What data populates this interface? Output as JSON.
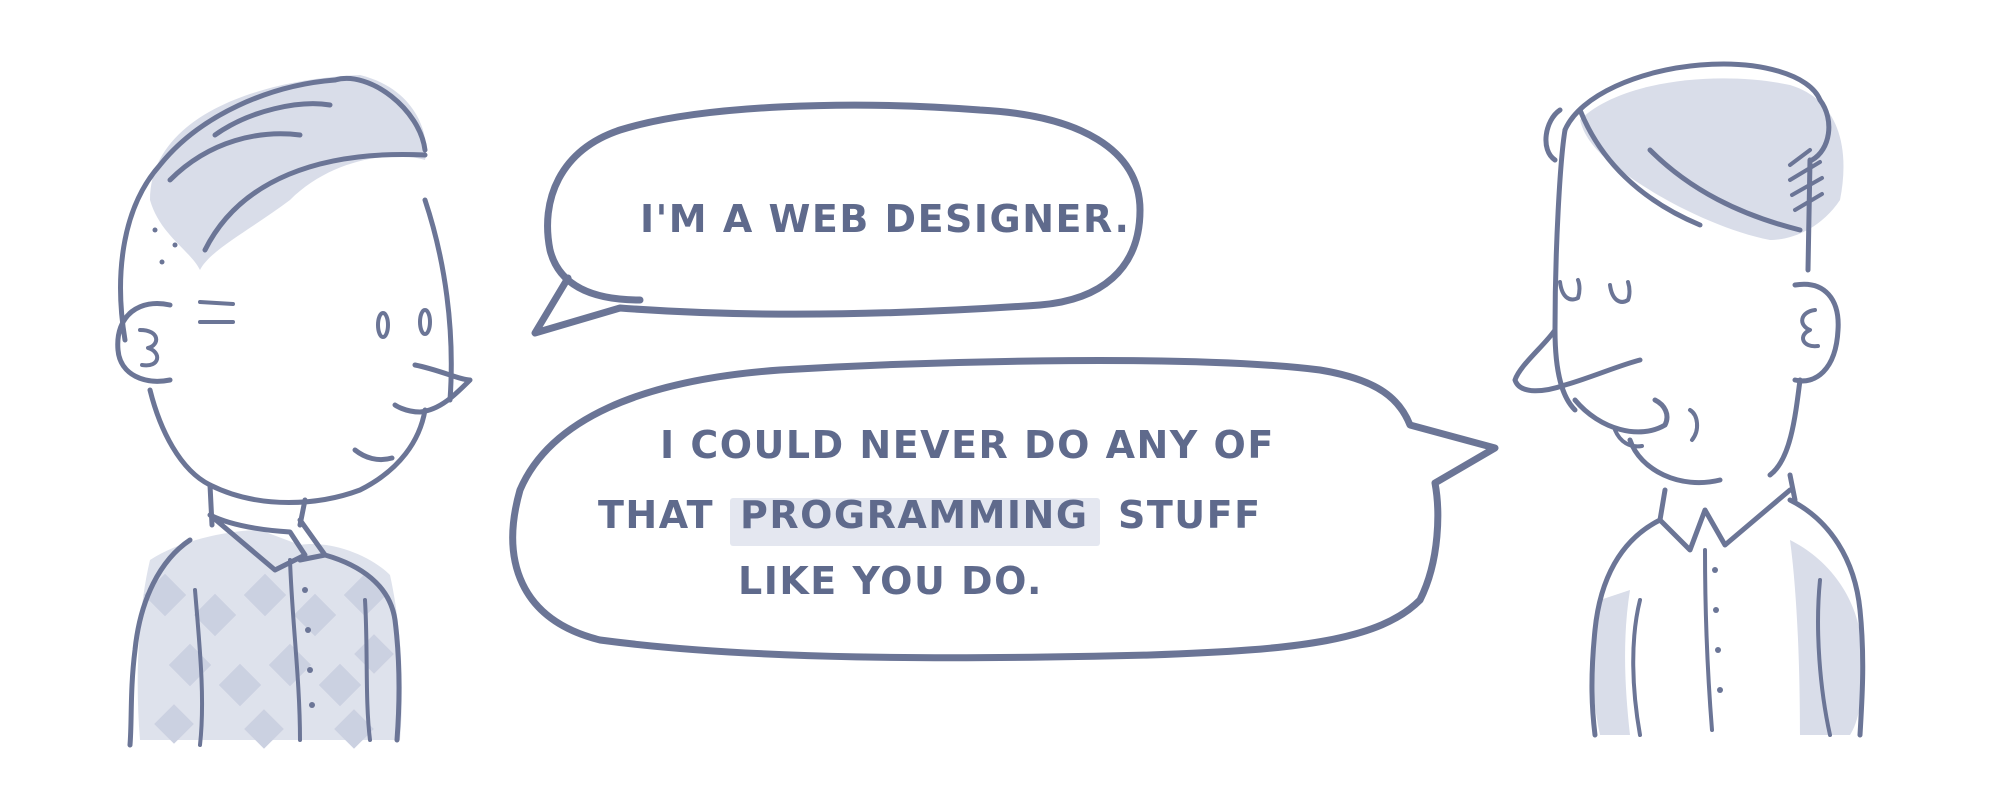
{
  "comic": {
    "bubble_left": {
      "line1": "I'M A WEB DESIGNER."
    },
    "bubble_right": {
      "line1": "I COULD NEVER DO ANY OF",
      "line2_pre": "THAT",
      "line2_highlight": "PROGRAMMING",
      "line2_post": "STUFF",
      "line3": "LIKE YOU DO."
    }
  },
  "colors": {
    "ink": "#6b7596",
    "wash": "#d9dde9",
    "highlight": "#e4e7f0"
  }
}
